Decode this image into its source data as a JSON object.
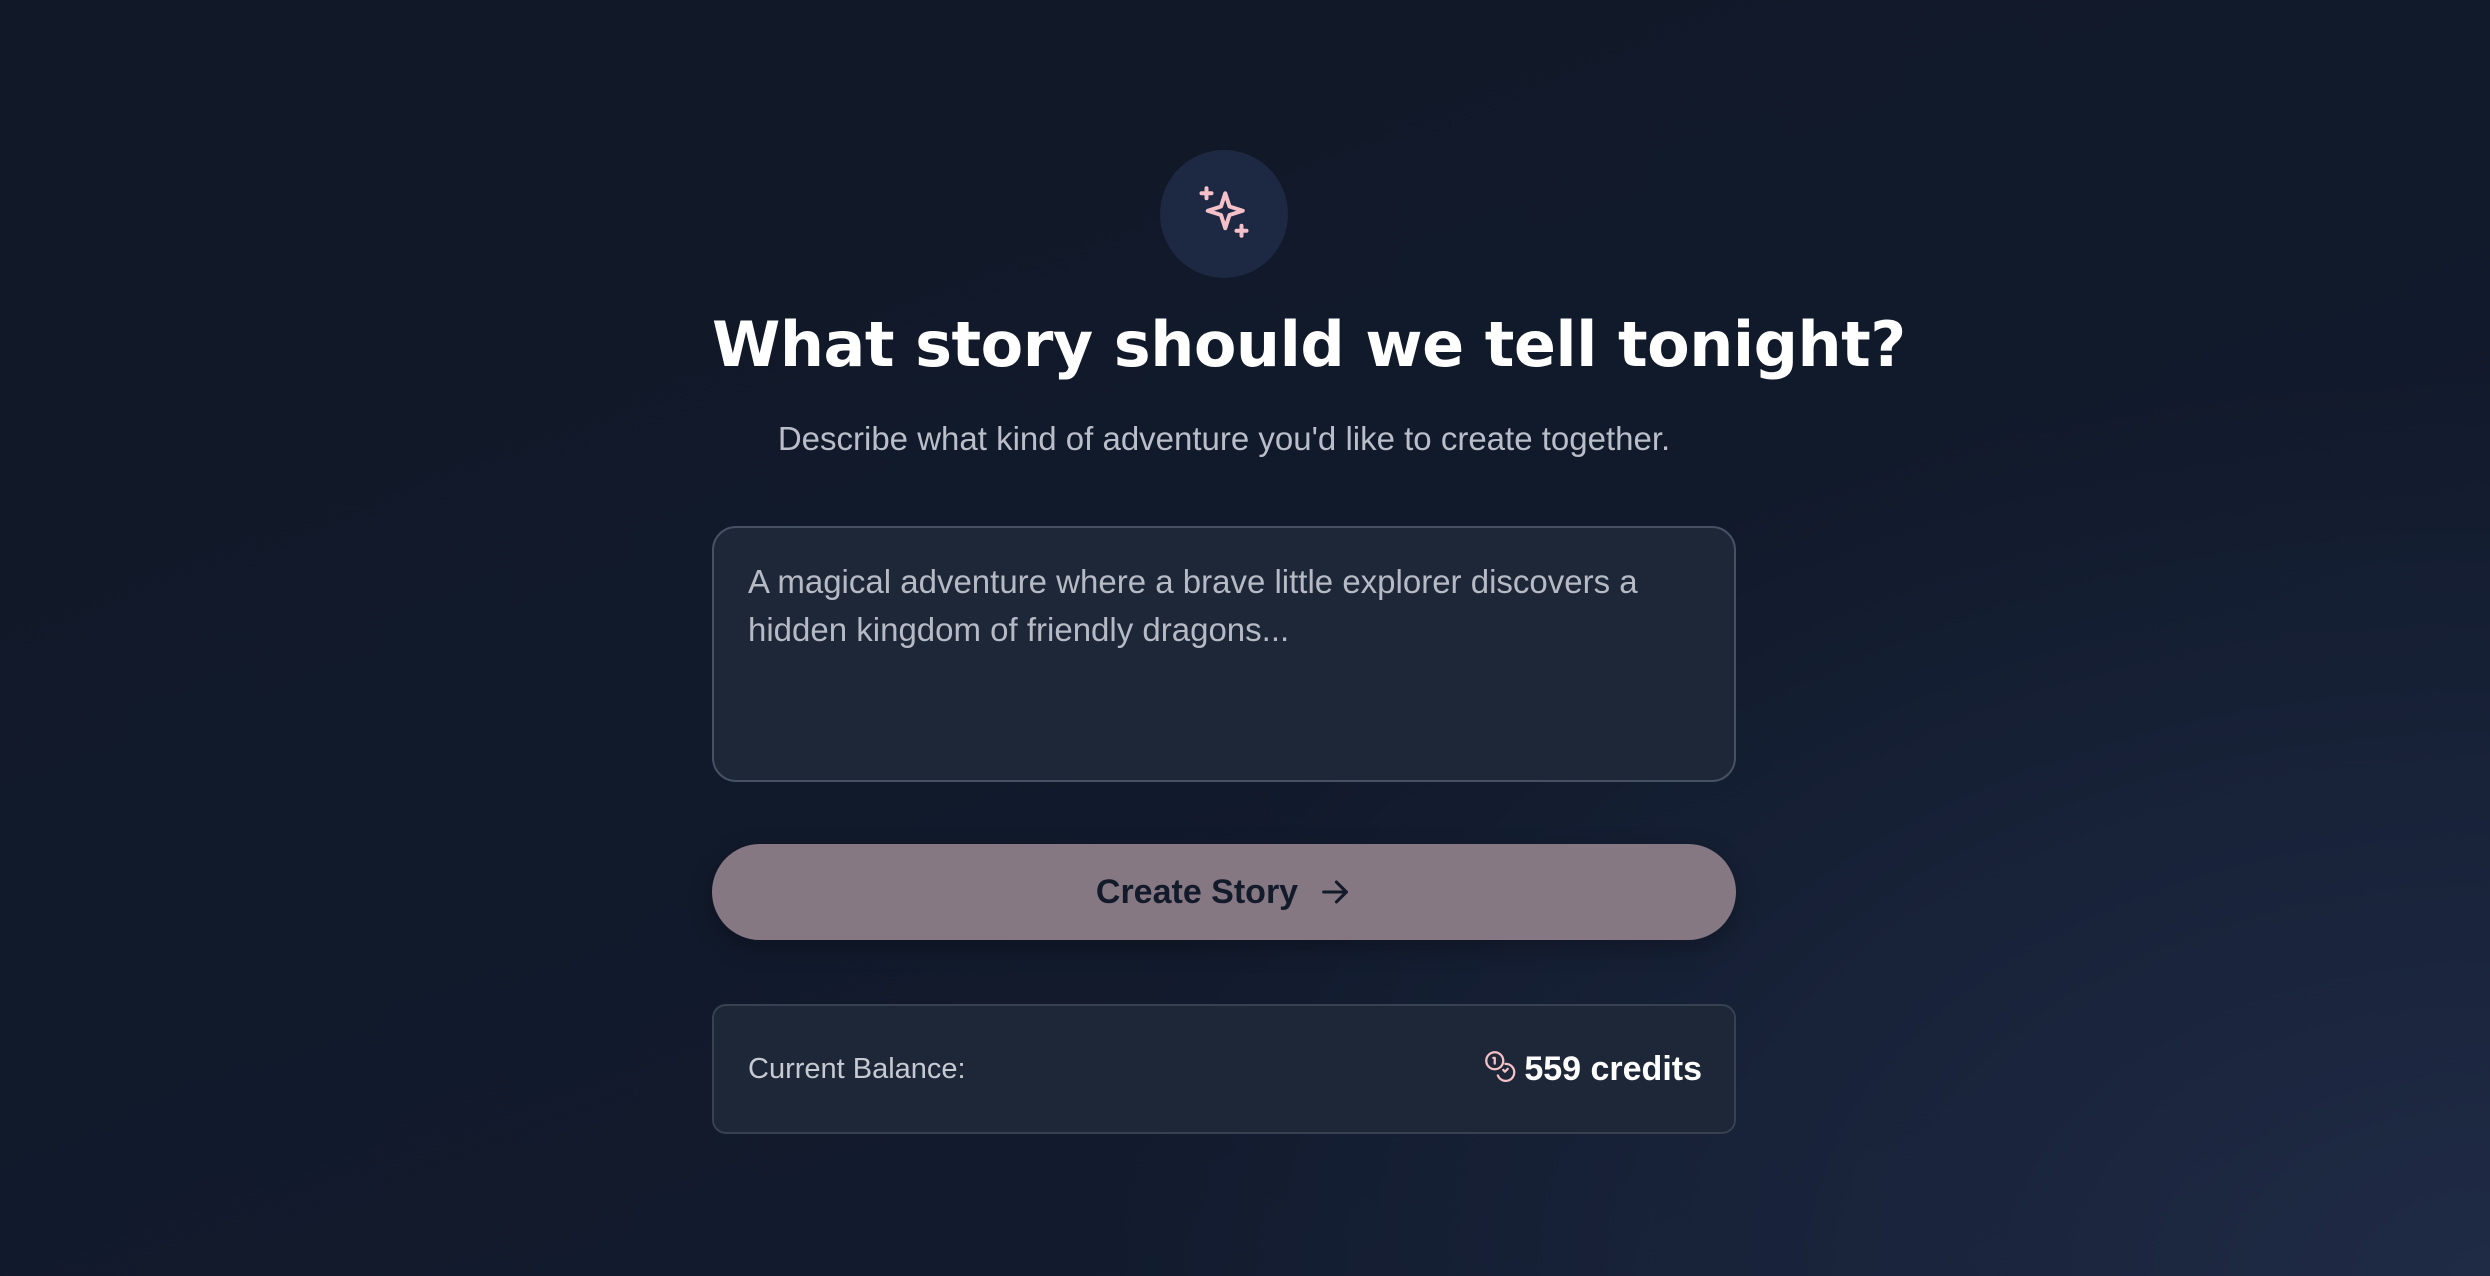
{
  "colors": {
    "accent_pink": "#f4c1c8",
    "button_bg": "#857883",
    "background": "#111827"
  },
  "hero": {
    "icon": "sparkles-icon",
    "title": "What story should we tell tonight?",
    "subtitle": "Describe what kind of adventure you'd like to create together."
  },
  "prompt": {
    "value": "",
    "placeholder": "A magical adventure where a brave little explorer discovers a hidden kingdom of friendly dragons..."
  },
  "create_button": {
    "label": "Create Story",
    "icon": "arrow-right-icon"
  },
  "balance": {
    "label": "Current Balance:",
    "icon": "coins-icon",
    "value": "559 credits"
  }
}
